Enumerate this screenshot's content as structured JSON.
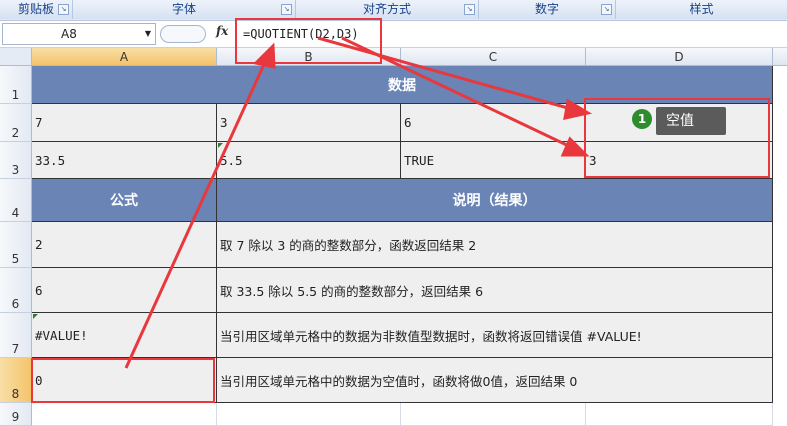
{
  "ribbon": {
    "groups": [
      "剪贴板",
      "字体",
      "对齐方式",
      "数字",
      "样式"
    ]
  },
  "formula_bar": {
    "name_box": "A8",
    "fx": "fx",
    "formula": "=QUOTIENT(D2,D3)"
  },
  "columns": [
    "A",
    "B",
    "C",
    "D"
  ],
  "rows": [
    "1",
    "2",
    "3",
    "4",
    "5",
    "6",
    "7",
    "8",
    "9"
  ],
  "sheet": {
    "data_header": "数据",
    "r2": {
      "a": "7",
      "b": "3",
      "c": "6",
      "d": ""
    },
    "r3": {
      "a": "33.5",
      "b": "5.5",
      "c": "TRUE",
      "d": "3"
    },
    "formula_header": "公式",
    "desc_header": "说明（结果）",
    "r5": {
      "a": "2",
      "b": "取 7 除以 3 的商的整数部分，函数返回结果 2"
    },
    "r6": {
      "a": "6",
      "b": "取 33.5 除以 5.5 的商的整数部分，返回结果 6"
    },
    "r7": {
      "a": "#VALUE!",
      "b": "当引用区域单元格中的数据为非数值型数据时，函数将返回错误值 #VALUE!"
    },
    "r8": {
      "a": "0",
      "b": "当引用区域单元格中的数据为空值时，函数将做0值，返回结果 0"
    }
  },
  "annotation": {
    "badge": "1",
    "tooltip": "空值"
  },
  "colors": {
    "header_bg": "#6a84b5",
    "highlight": "#e8383d",
    "cell_bg": "#efefef"
  }
}
